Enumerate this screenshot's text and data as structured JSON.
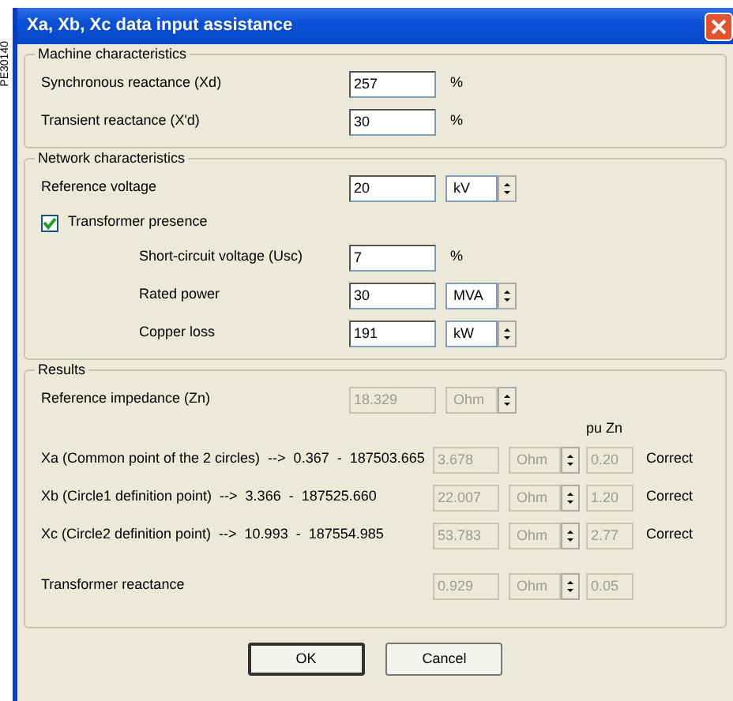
{
  "side_label": "PE30140",
  "window": {
    "title": "Xa, Xb, Xc data input assistance"
  },
  "groups": [
    {
      "title": "Machine characteristics",
      "rows": [
        {
          "kind": "field",
          "label": "Synchronous reactance (Xd)",
          "value": "257",
          "unit": "%"
        },
        {
          "kind": "field",
          "label": "Transient reactance (X'd)",
          "value": "30",
          "unit": "%"
        }
      ]
    },
    {
      "title": "Network characteristics",
      "rows": [
        {
          "kind": "spin",
          "label": "Reference voltage",
          "value": "20",
          "unit": "kV"
        },
        {
          "kind": "check",
          "label": "Transformer presence",
          "checked": true,
          "children": [
            {
              "kind": "field",
              "label": "Short-circuit voltage (Usc)",
              "value": "7",
              "unit": "%"
            },
            {
              "kind": "spin",
              "label": "Rated power",
              "value": "30",
              "unit": "MVA"
            },
            {
              "kind": "spin",
              "label": "Copper loss",
              "value": "191",
              "unit": "kW"
            }
          ]
        }
      ]
    },
    {
      "title": "Results",
      "rows": [
        {
          "kind": "spin",
          "label": "Reference impedance (Zn)",
          "value": "18.329",
          "unit": "Ohm",
          "disabled": true
        },
        {
          "kind": "header",
          "label": "pu Zn"
        },
        {
          "kind": "result",
          "label": "Xa (Common point of the 2 circles)  -->  0.367  -  187503.665",
          "value": "3.678",
          "unit": "Ohm",
          "pu": "0.20",
          "status": "Correct",
          "disabled": true
        },
        {
          "kind": "result",
          "label": "Xb (Circle1 definition point)  -->  3.366  -  187525.660",
          "value": "22.007",
          "unit": "Ohm",
          "pu": "1.20",
          "status": "Correct",
          "disabled": true
        },
        {
          "kind": "result",
          "label": "Xc (Circle2 definition point)  -->  10.993  -  187554.985",
          "value": "53.783",
          "unit": "Ohm",
          "pu": "2.77",
          "status": "Correct",
          "disabled": true
        },
        {
          "kind": "result",
          "label": "Transformer reactance",
          "value": "0.929",
          "unit": "Ohm",
          "pu": "0.05",
          "disabled": true,
          "gap": true
        }
      ]
    }
  ],
  "buttons": [
    {
      "label": "OK",
      "default": true
    },
    {
      "label": "Cancel",
      "default": false
    }
  ]
}
